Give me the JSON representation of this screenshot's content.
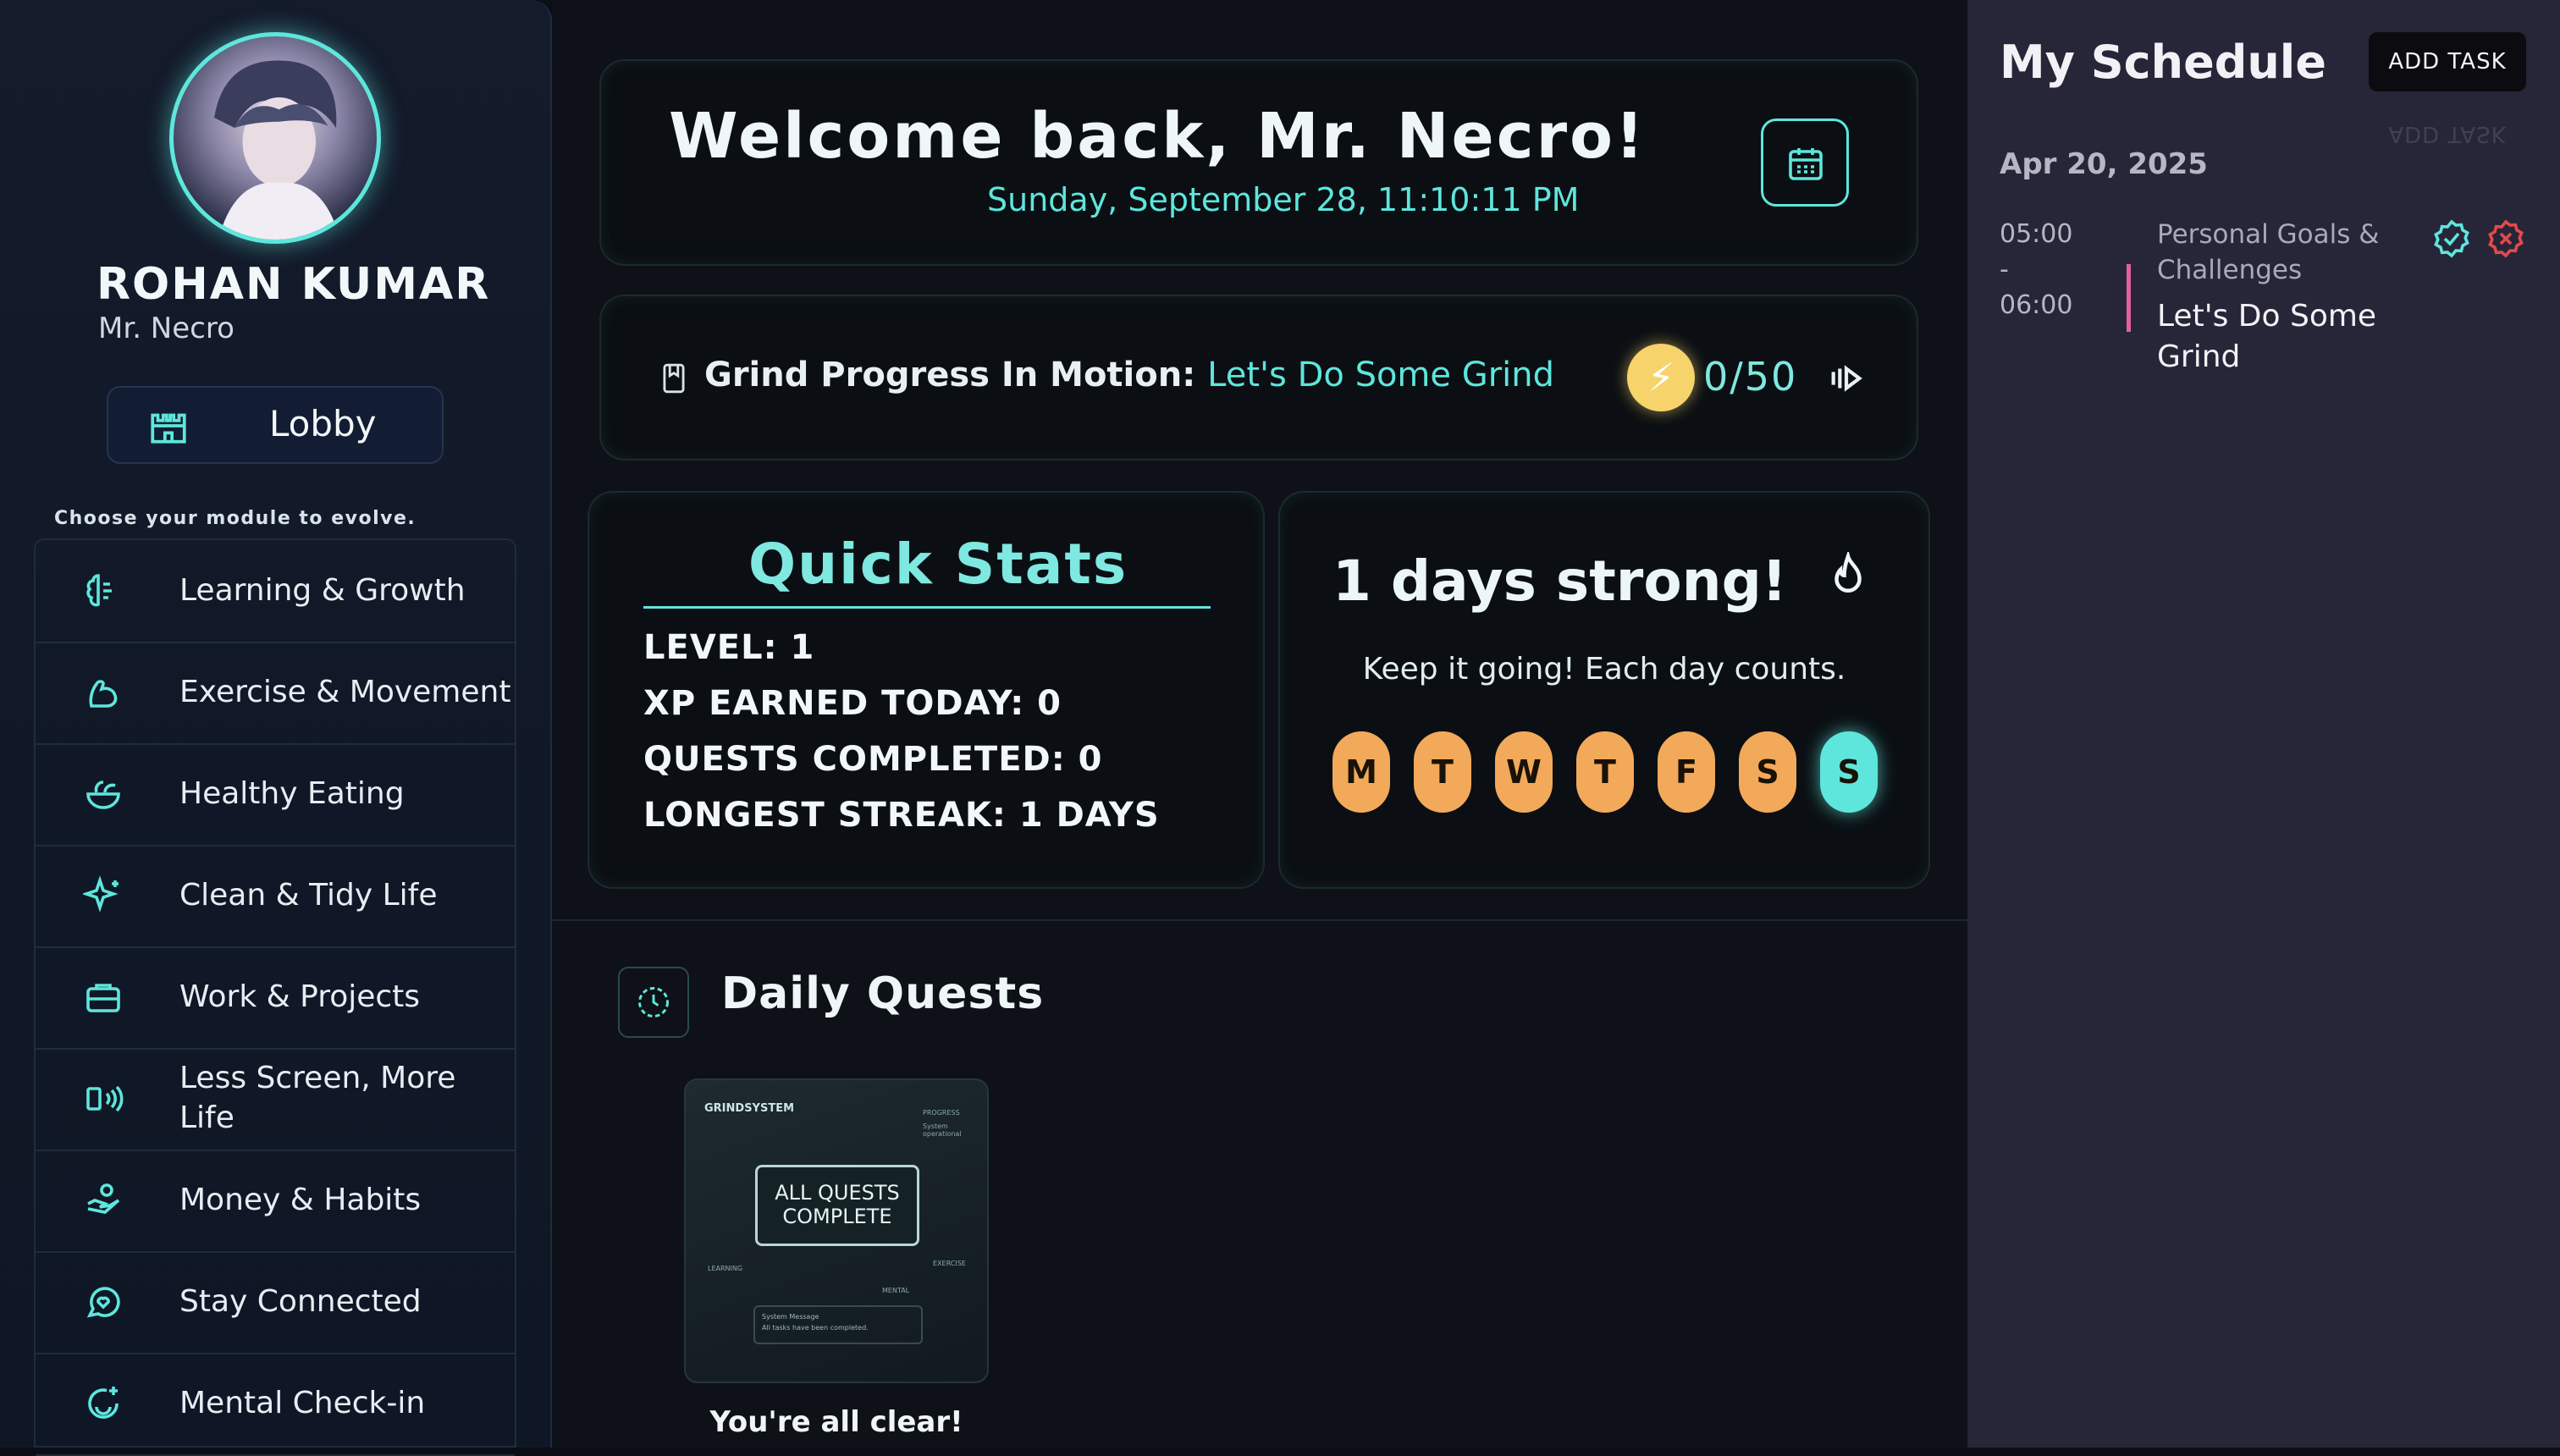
{
  "user": {
    "name": "ROHAN KUMAR",
    "alias": "Mr. Necro"
  },
  "lobby": {
    "label": "Lobby",
    "icon": "castle-icon"
  },
  "sidebar": {
    "prompt": "Choose your module to evolve.",
    "modules": [
      {
        "label": "Learning & Growth",
        "icon": "brain-icon"
      },
      {
        "label": "Exercise & Movement",
        "icon": "bicep-icon"
      },
      {
        "label": "Healthy Eating",
        "icon": "salad-icon"
      },
      {
        "label": "Clean & Tidy Life",
        "icon": "sparkles-icon"
      },
      {
        "label": "Work & Projects",
        "icon": "briefcase-icon"
      },
      {
        "label": "Less Screen, More Life",
        "icon": "phone-off-icon"
      },
      {
        "label": "Money & Habits",
        "icon": "hand-coins-icon"
      },
      {
        "label": "Stay Connected",
        "icon": "chat-heart-icon"
      },
      {
        "label": "Mental Check-in",
        "icon": "smile-plus-icon"
      }
    ]
  },
  "welcome": {
    "title": "Welcome back, Mr. Necro!",
    "datetime": "Sunday, September 28, 11:10:11 PM"
  },
  "progress": {
    "prefix": "Grind Progress In Motion:",
    "highlight": "Let's Do Some Grind",
    "count": "0/50",
    "current": 0,
    "total": 50
  },
  "stats": {
    "title": "Quick Stats",
    "level": "LEVEL: 1",
    "xp": "XP EARNED TODAY: 0",
    "quests": "QUESTS COMPLETED: 0",
    "streak": "LONGEST STREAK: 1 DAYS"
  },
  "streak": {
    "title": "1 days strong!",
    "message": "Keep it going! Each day counts.",
    "days": [
      "M",
      "T",
      "W",
      "T",
      "F",
      "S",
      "S"
    ],
    "active_day_index": 6,
    "colors": {
      "inactive": "#f3a95a",
      "active": "#5ee6dc"
    }
  },
  "quests": {
    "title": "Daily Quests",
    "thumbnail": {
      "brand": "GRINDSYSTEM",
      "status_1": "PROGRESS",
      "status_2": "System operational",
      "box": "ALL QUESTS COMPLETE",
      "labels": [
        "LEARNING",
        "MENTAL",
        "EXERCISE"
      ],
      "msg_title": "System Message",
      "msg_body": "All tasks have been completed."
    },
    "empty_text": "You're all clear!"
  },
  "schedule": {
    "title": "My Schedule",
    "add_task": "ADD TASK",
    "date": "Apr 20, 2025",
    "tasks": [
      {
        "start": "05:00",
        "sep": "-",
        "end": "06:00",
        "category": "Personal Goals & Challenges",
        "name": "Let's Do Some Grind"
      }
    ]
  },
  "theme": {
    "accent": "#5ee6dc",
    "task_bar": "#e5609a",
    "danger": "#e5484d",
    "bolt": "#f7d36c"
  }
}
